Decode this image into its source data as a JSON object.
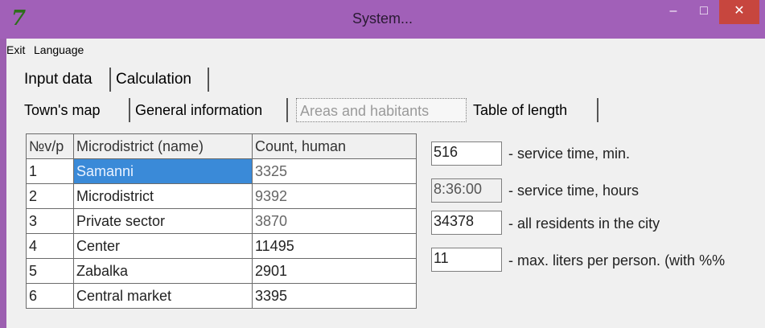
{
  "window": {
    "title": "System...",
    "icon": "app-logo-icon",
    "controls": {
      "minimize": "–",
      "maximize": "□",
      "close": "✕"
    }
  },
  "menu": [
    "Exit",
    "Language"
  ],
  "main_tabs": [
    "Input data",
    "Calculation"
  ],
  "sub_tabs": [
    "Town's map",
    "General information",
    "Areas and habitants",
    "Table of length"
  ],
  "table": {
    "headers": [
      "№v/p",
      "Microdistrict (name)",
      "Count, human"
    ],
    "rows": [
      [
        "1",
        "Samanni",
        "3325"
      ],
      [
        "2",
        "Microdistrict",
        "9392"
      ],
      [
        "3",
        "Private sector",
        "3870"
      ],
      [
        "4",
        "Center",
        "11495"
      ],
      [
        "5",
        "Zabalka",
        "2901"
      ],
      [
        "6",
        "Central market",
        "3395"
      ]
    ]
  },
  "fields": [
    {
      "value": "516",
      "label": "- service time, min."
    },
    {
      "value": "8:36:00",
      "label": "- service time, hours"
    },
    {
      "value": "34378",
      "label": "- all residents in the city"
    },
    {
      "value": "11",
      "label": "- max. liters per person. (with %%"
    }
  ],
  "colors": {
    "titlebar": "#a160b8",
    "close": "#c7463e",
    "selection": "#3a8ad8"
  }
}
